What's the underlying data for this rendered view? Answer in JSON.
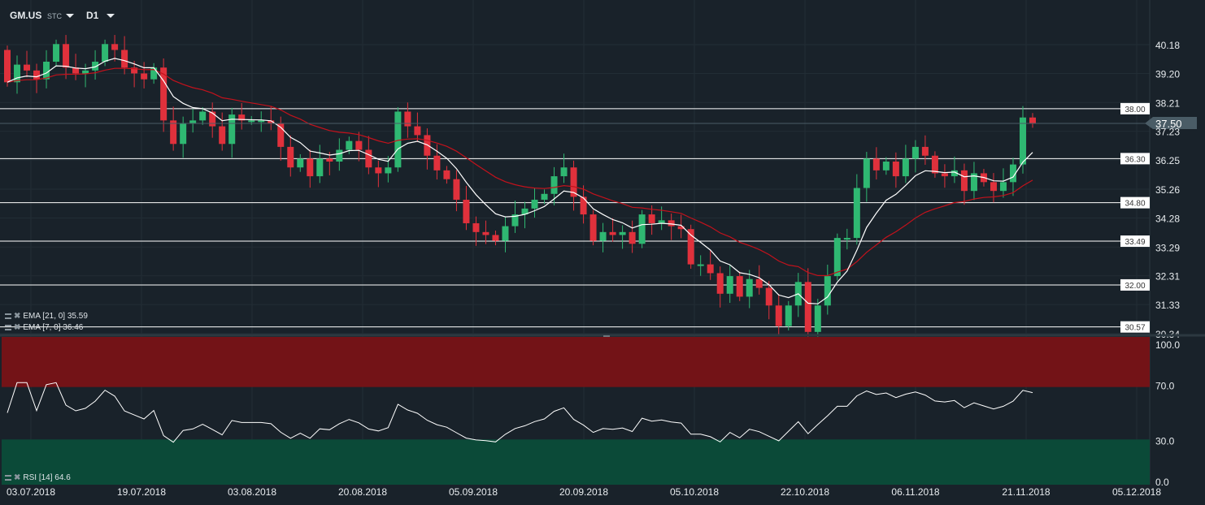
{
  "header": {
    "symbol": "GM.US",
    "type": "STC",
    "interval": "D1"
  },
  "legend": {
    "ema21": "EMA [21, 0] 35.59",
    "ema7": "EMA [7, 0] 36.46",
    "rsi": "RSI [14] 64.6"
  },
  "colors": {
    "bg": "#19222a",
    "up": "#2fb872",
    "down": "#e0313c",
    "ema7": "#ffffff",
    "ema21": "#c3121c",
    "rsi_over": "#731317",
    "rsi_under": "#0b4a38",
    "tag": "#4a5c66"
  },
  "price_axis": [
    "40.18",
    "39.20",
    "38.21",
    "37.23",
    "36.25",
    "35.26",
    "34.28",
    "33.29",
    "32.31",
    "31.33",
    "30.34"
  ],
  "current_price": "37.50",
  "levels": [
    "38.00",
    "36.30",
    "34.80",
    "33.49",
    "32.00",
    "30.57"
  ],
  "rsi_axis": [
    "100.0",
    "70.0",
    "30.0",
    "0.0"
  ],
  "dates": [
    "03.07.2018",
    "19.07.2018",
    "03.08.2018",
    "20.08.2018",
    "05.09.2018",
    "20.09.2018",
    "05.10.2018",
    "22.10.2018",
    "06.11.2018",
    "21.11.2018",
    "05.12.2018"
  ],
  "chart_data": {
    "type": "candlestick",
    "price_range": [
      30.34,
      40.18
    ],
    "first_open": 40.0,
    "closes": [
      38.9,
      39.5,
      39.3,
      39.0,
      39.6,
      40.2,
      39.4,
      39.2,
      39.3,
      39.6,
      40.2,
      40.0,
      39.4,
      39.2,
      39.0,
      39.4,
      37.6,
      36.8,
      37.5,
      37.6,
      37.9,
      37.4,
      36.8,
      37.8,
      37.6,
      37.6,
      37.6,
      37.5,
      36.7,
      36.0,
      36.3,
      35.7,
      36.3,
      36.2,
      36.6,
      36.9,
      36.6,
      36.0,
      35.8,
      36.0,
      37.9,
      37.4,
      37.1,
      36.4,
      35.9,
      35.6,
      34.9,
      34.1,
      33.8,
      33.7,
      33.5,
      34.0,
      34.4,
      34.6,
      34.9,
      35.1,
      35.7,
      36.0,
      35.0,
      34.4,
      33.5,
      33.8,
      33.7,
      33.8,
      33.4,
      34.4,
      34.1,
      34.2,
      34.0,
      33.9,
      32.7,
      32.7,
      32.4,
      31.7,
      32.3,
      31.6,
      32.2,
      31.9,
      31.3,
      30.6,
      31.3,
      32.1,
      30.4,
      31.3,
      32.3,
      33.6,
      33.6,
      35.3,
      36.3,
      35.9,
      36.2,
      35.7,
      36.3,
      36.7,
      36.4,
      35.8,
      35.7,
      35.9,
      35.2,
      35.8,
      35.5,
      35.2,
      35.5,
      36.1,
      37.7,
      37.5
    ],
    "ema_periods": [
      7,
      21
    ],
    "rsi_period": 14,
    "rsi_range": [
      0,
      100
    ]
  }
}
